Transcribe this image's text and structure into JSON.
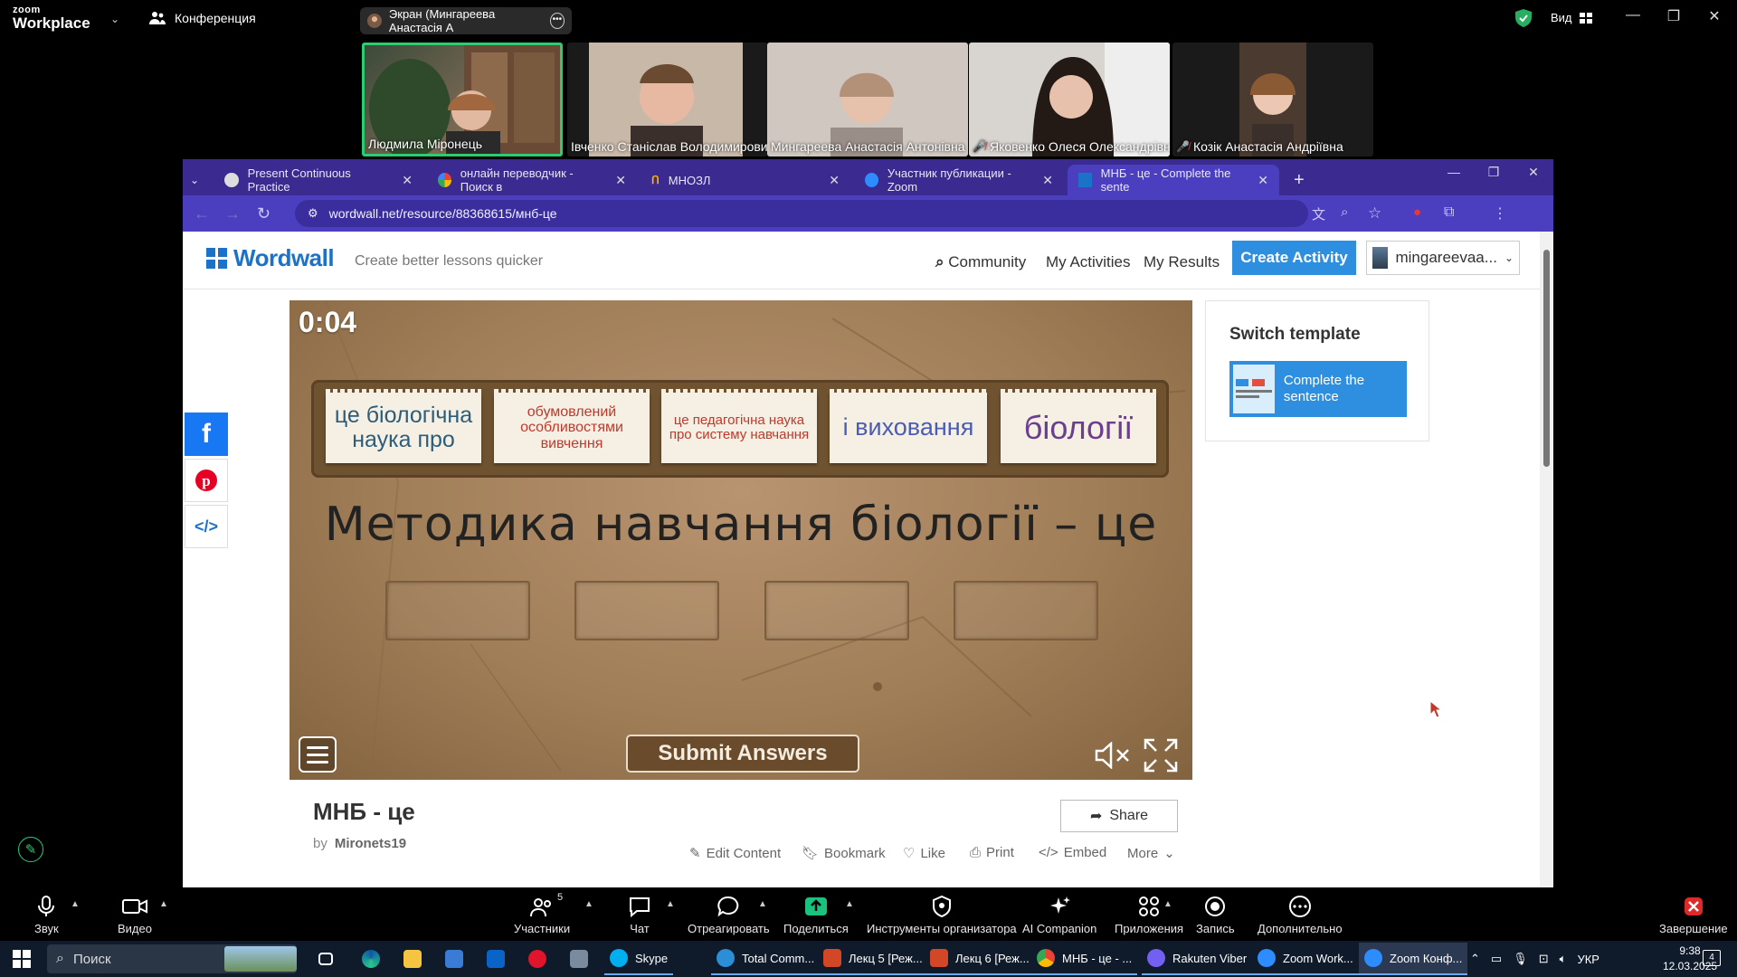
{
  "zoom_top": {
    "logo_line1": "zoom",
    "logo_line2": "Workplace",
    "conference_label": "Конференция",
    "screen_share_label": "Экран (Мингареева Анастасія А",
    "view_label": "Вид"
  },
  "participants": [
    {
      "name": "Людмила Міронець",
      "muted": false
    },
    {
      "name": "Івченко Станіслав Володимирович",
      "muted": false
    },
    {
      "name": "Мингареева Анастасія Антонівна",
      "muted": false
    },
    {
      "name": "Яковенко Олеся Олександрівна",
      "muted": true
    },
    {
      "name": "Козік Анастасія Андріївна",
      "muted": true
    }
  ],
  "browser": {
    "tabs": [
      {
        "label": "Present Continuous Practice",
        "active": false
      },
      {
        "label": "онлайн переводчик - Поиск в",
        "active": false
      },
      {
        "label": "МНОЗЛ",
        "active": false
      },
      {
        "label": "Участник публикации - Zoom",
        "active": false
      },
      {
        "label": "МНБ - це - Complete the sente",
        "active": true
      }
    ],
    "url": "wordwall.net/resource/88368615/мнб-це"
  },
  "wordwall": {
    "logo": "Wordwall",
    "tagline": "Create better lessons quicker",
    "nav": {
      "community": "Community",
      "my_activities": "My Activities",
      "my_results": "My Results",
      "create_activity": "Create Activity",
      "user": "mingareevaa..."
    },
    "game": {
      "timer": "0:04",
      "cards": [
        {
          "text": "це біологічна наука про",
          "color": "#2c5d7a",
          "size": "large"
        },
        {
          "text": "обумовлений особливостями вивчення",
          "color": "#c0392b",
          "size": "small"
        },
        {
          "text": "це педагогічна наука про систему навчання",
          "color": "#c0392b",
          "size": "small"
        },
        {
          "text": "і виховання",
          "color": "#4a5db5",
          "size": "large"
        },
        {
          "text": "біології",
          "color": "#6b3f8f",
          "size": "xlarge"
        }
      ],
      "question": "Методика навчання біології – це",
      "blank_count": 4,
      "submit_label": "Submit Answers"
    },
    "switch_template": {
      "title": "Switch template",
      "option": "Complete the sentence"
    },
    "activity": {
      "title": "МНБ - це",
      "by": "by",
      "author": "Mironets19",
      "share": "Share",
      "links": [
        "Edit Content",
        "Bookmark",
        "Like",
        "Print",
        "Embed",
        "More"
      ]
    },
    "social": [
      "facebook-icon",
      "pinterest-icon",
      "embed-code-icon"
    ]
  },
  "zoom_toolbar": {
    "items": [
      {
        "label": "Звук",
        "icon": "microphone-icon"
      },
      {
        "label": "Видео",
        "icon": "video-camera-icon"
      },
      {
        "label": "Участники",
        "icon": "participants-icon",
        "count": "5"
      },
      {
        "label": "Чат",
        "icon": "chat-icon"
      },
      {
        "label": "Отреагировать",
        "icon": "reaction-icon"
      },
      {
        "label": "Поделиться",
        "icon": "share-screen-icon"
      },
      {
        "label": "Инструменты организатора",
        "icon": "host-tools-icon"
      },
      {
        "label": "AI Companion",
        "icon": "ai-companion-icon"
      },
      {
        "label": "Приложения",
        "icon": "apps-icon"
      },
      {
        "label": "Запись",
        "icon": "record-icon"
      },
      {
        "label": "Дополнительно",
        "icon": "more-icon"
      },
      {
        "label": "Завершение",
        "icon": "end-meeting-icon"
      }
    ]
  },
  "taskbar": {
    "search": "Поиск",
    "apps": [
      {
        "label": "Skype"
      },
      {
        "label": "Total Comm..."
      },
      {
        "label": "Лекц 5 [Реж..."
      },
      {
        "label": "Лекц 6 [Реж..."
      },
      {
        "label": "МНБ - це - ..."
      },
      {
        "label": "Rakuten Viber"
      },
      {
        "label": "Zoom Work..."
      },
      {
        "label": "Zoom Конф..."
      }
    ],
    "lang": "УКР",
    "time": "9:38",
    "date": "12.03.2025",
    "notifications": "4"
  }
}
